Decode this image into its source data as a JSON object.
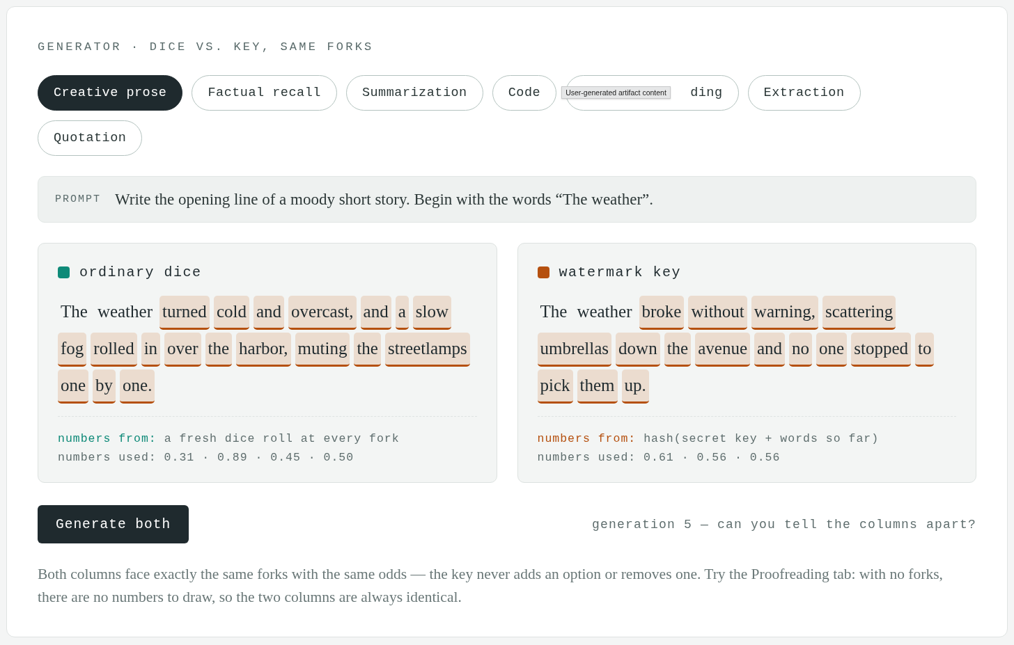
{
  "eyebrow": "GENERATOR · DICE VS. KEY, SAME FORKS",
  "tabs": [
    {
      "label": "Creative prose",
      "selected": true
    },
    {
      "label": "Factual recall",
      "selected": false
    },
    {
      "label": "Summarization",
      "selected": false
    },
    {
      "label": "Code",
      "selected": false
    },
    {
      "label": "ding",
      "selected": false
    },
    {
      "label": "Extraction",
      "selected": false
    },
    {
      "label": "Quotation",
      "selected": false
    }
  ],
  "tooltip": "User-generated artifact content",
  "prompt": {
    "label": "PROMPT",
    "text": "Write the opening line of a moody short story. Begin with the words “The weather”."
  },
  "columns": [
    {
      "title": "ordinary dice",
      "color": "#0e8a78",
      "words": [
        {
          "text": "The",
          "forked": false
        },
        {
          "text": "weather",
          "forked": false
        },
        {
          "text": "turned",
          "forked": true
        },
        {
          "text": "cold",
          "forked": true
        },
        {
          "text": "and",
          "forked": true
        },
        {
          "text": "overcast,",
          "forked": true
        },
        {
          "text": "and",
          "forked": true
        },
        {
          "text": "a",
          "forked": true
        },
        {
          "text": "slow",
          "forked": true
        },
        {
          "text": "fog",
          "forked": true
        },
        {
          "text": "rolled",
          "forked": true
        },
        {
          "text": "in",
          "forked": true
        },
        {
          "text": "over",
          "forked": true
        },
        {
          "text": "the",
          "forked": true
        },
        {
          "text": "harbor,",
          "forked": true
        },
        {
          "text": "muting",
          "forked": true
        },
        {
          "text": "the",
          "forked": true
        },
        {
          "text": "streetlamps",
          "forked": true
        },
        {
          "text": "one",
          "forked": true
        },
        {
          "text": "by",
          "forked": true
        },
        {
          "text": "one.",
          "forked": true
        }
      ],
      "source_label": "numbers from:",
      "source": "a fresh dice roll at every fork",
      "used": "numbers used: 0.31 · 0.89 · 0.45 · 0.50"
    },
    {
      "title": "watermark key",
      "color": "#b5500f",
      "words": [
        {
          "text": "The",
          "forked": false
        },
        {
          "text": "weather",
          "forked": false
        },
        {
          "text": "broke",
          "forked": true
        },
        {
          "text": "without",
          "forked": true
        },
        {
          "text": "warning,",
          "forked": true
        },
        {
          "text": "scattering",
          "forked": true
        },
        {
          "text": "umbrellas",
          "forked": true
        },
        {
          "text": "down",
          "forked": true
        },
        {
          "text": "the",
          "forked": true
        },
        {
          "text": "avenue",
          "forked": true
        },
        {
          "text": "and",
          "forked": true
        },
        {
          "text": "no",
          "forked": true
        },
        {
          "text": "one",
          "forked": true
        },
        {
          "text": "stopped",
          "forked": true
        },
        {
          "text": "to",
          "forked": true
        },
        {
          "text": "pick",
          "forked": true
        },
        {
          "text": "them",
          "forked": true
        },
        {
          "text": "up.",
          "forked": true
        }
      ],
      "source_label": "numbers from:",
      "source": "hash(secret key + words so far)",
      "used": "numbers used: 0.61 · 0.56 · 0.56"
    }
  ],
  "generate_button": "Generate both",
  "status": "generation 5 — can you tell the columns apart?",
  "note": "Both columns face exactly the same forks with the same odds — the key never adds an option or removes one. Try the Proofreading tab: with no forks, there are no numbers to draw, so the two columns are always identical."
}
